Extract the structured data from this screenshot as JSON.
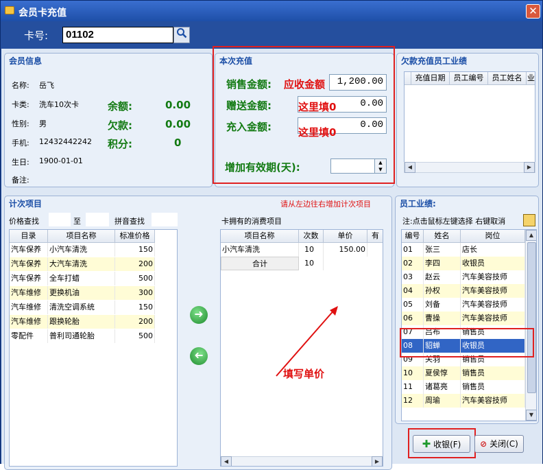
{
  "window": {
    "title": "会员卡充值",
    "close_glyph": "✕"
  },
  "card": {
    "label": "卡号:",
    "value": "01102"
  },
  "member_info": {
    "title": "会员信息",
    "fields": [
      {
        "label": "名称:",
        "value": "岳飞"
      },
      {
        "label": "卡类:",
        "value": "洗车10次卡"
      },
      {
        "label": "性别:",
        "value": "男"
      },
      {
        "label": "手机:",
        "value": "12432442242"
      },
      {
        "label": "生日:",
        "value": "1900-01-01"
      },
      {
        "label": "备注:",
        "value": ""
      }
    ],
    "balance": [
      {
        "label": "余额:",
        "value": "0.00"
      },
      {
        "label": "欠款:",
        "value": "0.00"
      },
      {
        "label": "积分:",
        "value": "0"
      }
    ]
  },
  "recharge": {
    "title": "本次充值",
    "sale_label": "销售金额:",
    "sale_hint": "应收金额",
    "sale_value": "1,200.00",
    "gift_label": "赠送金额:",
    "gift_hint": "这里填0",
    "gift_value": "0.00",
    "charge_label": "充入金额:",
    "charge_hint": "这里填0",
    "charge_value": "0.00",
    "validity_label": "增加有效期(天):",
    "validity_value": ""
  },
  "debt": {
    "title": "欠款充值员工业绩",
    "columns": [
      "充值日期",
      "员工编号",
      "员工姓名",
      "业"
    ]
  },
  "count_items": {
    "title": "计次项目",
    "hint": "请从左边往右增加计次项目",
    "price_search": "价格查找",
    "to": "至",
    "pinyin_search": "拼音查找",
    "columns": [
      "目录",
      "项目名称",
      "标准价格"
    ],
    "rows": [
      [
        "汽车保养",
        "小汽车清洗",
        "150"
      ],
      [
        "汽车保养",
        "大汽车清洗",
        "200"
      ],
      [
        "汽车保养",
        "全车打蜡",
        "500"
      ],
      [
        "汽车维修",
        "更换机油",
        "300"
      ],
      [
        "汽车维修",
        "清洗空调系统",
        "150"
      ],
      [
        "汽车维修",
        "跟换轮胎",
        "200"
      ],
      [
        "零配件",
        "普利司通轮胎",
        "500"
      ]
    ],
    "owned_title": "卡拥有的消费项目",
    "owned_columns": [
      "项目名称",
      "次数",
      "单价",
      "有"
    ],
    "owned_rows": [
      [
        "小汽车清洗",
        "10",
        "150.00",
        ""
      ]
    ],
    "total_label": "合计",
    "total_count": "10",
    "annotation": "填写单价"
  },
  "staff": {
    "title": "员工业绩:",
    "hint": "注:点击鼠标左键选择 右键取消",
    "columns": [
      "编号",
      "姓名",
      "岗位"
    ],
    "rows": [
      [
        "01",
        "张三",
        "店长"
      ],
      [
        "02",
        "李四",
        "收银员"
      ],
      [
        "03",
        "赵云",
        "汽车美容技师"
      ],
      [
        "04",
        "孙权",
        "汽车美容技师"
      ],
      [
        "05",
        "刘备",
        "汽车美容技师"
      ],
      [
        "06",
        "曹操",
        "汽车美容技师"
      ],
      [
        "07",
        "吕布",
        "销售员"
      ],
      [
        "08",
        "貂蝉",
        "收银员"
      ],
      [
        "09",
        "关羽",
        "销售员"
      ],
      [
        "10",
        "夏侯惇",
        "销售员"
      ],
      [
        "11",
        "诸葛亮",
        "销售员"
      ],
      [
        "12",
        "周瑜",
        "汽车美容技师"
      ]
    ],
    "selected_index": 7
  },
  "buttons": {
    "collect": "收银(F)",
    "close": "关闭(C)"
  },
  "colors": {
    "title_blue": "#254f9e",
    "label_blue": "#1b4ea6",
    "value_green": "#127a12",
    "annotation_red": "#e01010",
    "selected": "#3165c5",
    "alt_row": "#fffcd6"
  }
}
